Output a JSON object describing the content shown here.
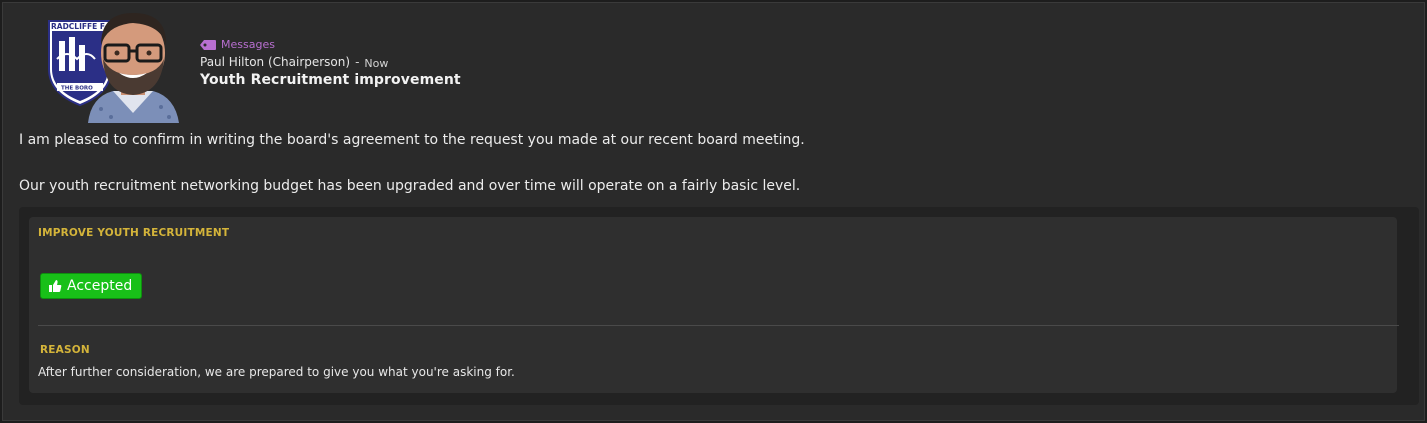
{
  "header": {
    "category": "Messages",
    "sender": "Paul Hilton (Chairperson)",
    "separator": "-",
    "time": "Now",
    "subject": "Youth Recruitment improvement"
  },
  "crest": {
    "club_text": "RADCLIFFE F",
    "banner_text": "THE BORO"
  },
  "body": {
    "paragraph_1": "I am pleased to confirm in writing the board's agreement to the request you made at our recent board meeting.",
    "paragraph_2": "Our youth recruitment networking budget has been upgraded and over time will operate on a fairly basic level."
  },
  "request": {
    "title": "IMPROVE YOUTH RECRUITMENT",
    "status_label": "Accepted",
    "status_icon": "thumbs-up-icon",
    "reason_title": "REASON",
    "reason_text": "After further consideration, we are prepared to give you what you're asking for."
  },
  "colors": {
    "category": "#b86fd0",
    "accent_heading": "#d4b43a",
    "accepted": "#18c018",
    "crest_blue": "#2b2f86"
  }
}
